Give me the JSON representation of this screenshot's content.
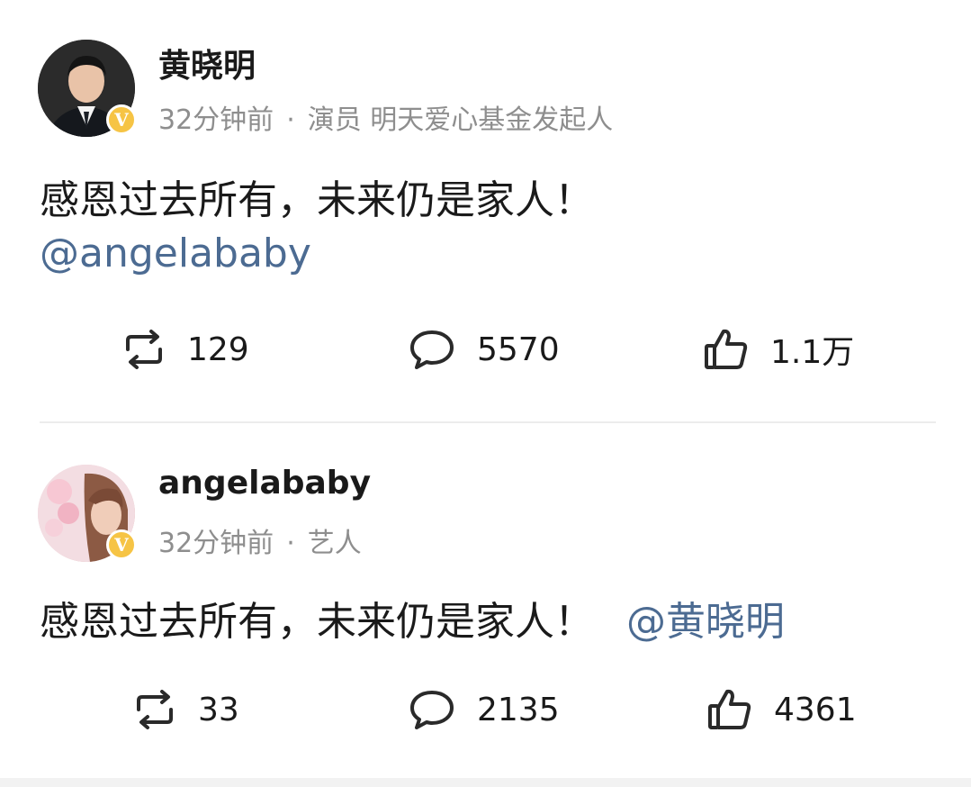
{
  "posts": [
    {
      "username": "黄晓明",
      "time": "32分钟前",
      "separator": "·",
      "description": "演员 明天爱心基金发起人",
      "text": "感恩过去所有，未来仍是家人！",
      "mention": "@angelababy",
      "stats": {
        "reposts": "129",
        "comments": "5570",
        "likes": "1.1万"
      },
      "verified_badge": "V"
    },
    {
      "username": "angelababy",
      "time": "32分钟前",
      "separator": "·",
      "description": "艺人",
      "text": "感恩过去所有，未来仍是家人！",
      "mention": "@黄晓明",
      "stats": {
        "reposts": "33",
        "comments": "2135",
        "likes": "4361"
      },
      "verified_badge": "V"
    }
  ],
  "icons": {
    "repost": "repost-icon",
    "comment": "comment-icon",
    "like": "like-icon",
    "verified": "verified-badge-icon"
  },
  "colors": {
    "mention": "#4c6b92",
    "meta": "#8e8e8e",
    "verified": "#f6c445"
  }
}
